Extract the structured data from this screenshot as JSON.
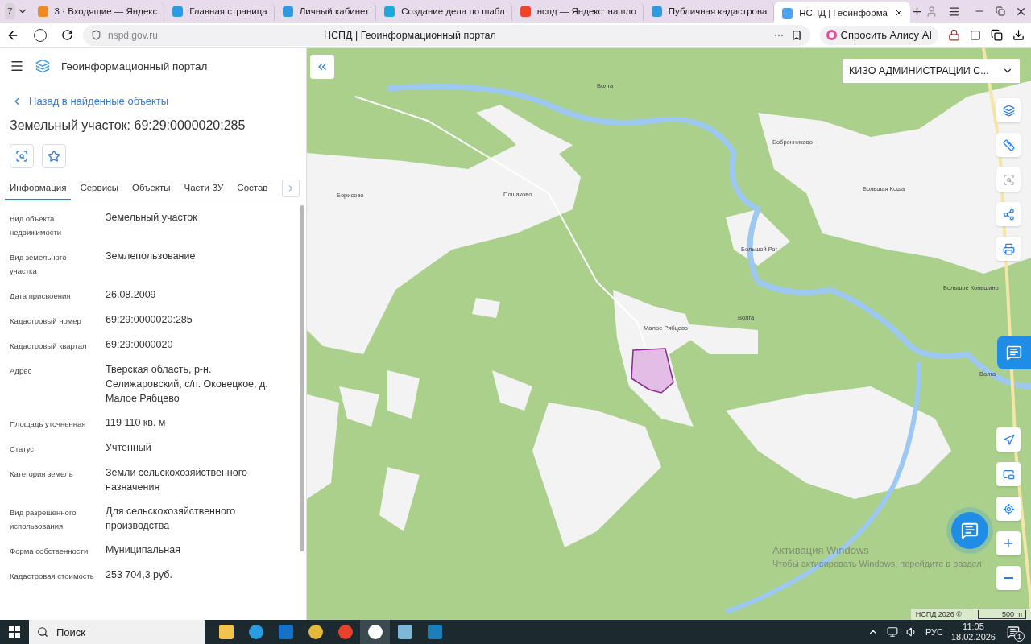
{
  "browser": {
    "tab_count": "7",
    "tabs": [
      {
        "title": "3 · Входящие — Яндекс",
        "selected": false,
        "color": "#f08a24"
      },
      {
        "title": "Главная страница",
        "selected": false,
        "color": "#2e9be0"
      },
      {
        "title": "Личный кабинет",
        "selected": false,
        "color": "#2e9be0"
      },
      {
        "title": "Создание дела по шабл",
        "selected": false,
        "color": "#1ea8e0"
      },
      {
        "title": "нспд — Яндекс: нашло",
        "selected": false,
        "color": "#f0432c"
      },
      {
        "title": "Публичная кадастрова",
        "selected": false,
        "color": "#2e9be0"
      },
      {
        "title": "НСПД | Геоинформа",
        "selected": true,
        "color": "#4aa3f0"
      }
    ],
    "url": "nspd.gov.ru",
    "page_title": "НСПД | Геоинформационный портал",
    "alice_button": "Спросить Алису AI"
  },
  "panel": {
    "portal_title": "Геоинформационный портал",
    "back_link": "Назад в найденные объекты",
    "heading": "Земельный участок: 69:29:0000020:285",
    "tabs": [
      {
        "label": "Информация",
        "selected": true
      },
      {
        "label": "Сервисы",
        "selected": false
      },
      {
        "label": "Объекты",
        "selected": false
      },
      {
        "label": "Части ЗУ",
        "selected": false
      },
      {
        "label": "Состав",
        "selected": false
      }
    ],
    "fields": [
      {
        "label": "Вид объекта недвижимости",
        "value": "Земельный участок"
      },
      {
        "label": "Вид земельного участка",
        "value": "Землепользование"
      },
      {
        "label": "Дата присвоения",
        "value": "26.08.2009"
      },
      {
        "label": "Кадастровый номер",
        "value": "69:29:0000020:285"
      },
      {
        "label": "Кадастровый квартал",
        "value": "69:29:0000020"
      },
      {
        "label": "Адрес",
        "value": "Тверская область, р-н. Селижаровский, с/п. Оковецкое, д. Малое Рябцево"
      },
      {
        "label": "Площадь уточненная",
        "value": "119 110 кв. м"
      },
      {
        "label": "Статус",
        "value": "Учтенный"
      },
      {
        "label": "Категория земель",
        "value": "Земли сельскохозяйственного назначения"
      },
      {
        "label": "Вид разрешенного использования",
        "value": "Для сельскохозяйственного производства"
      },
      {
        "label": "Форма собственности",
        "value": "Муниципальная"
      },
      {
        "label": "Кадастровая стоимость",
        "value": "253 704,3 руб."
      }
    ]
  },
  "map": {
    "layer_select": "КИЗО АДМИНИСТРАЦИИ С...",
    "labels": [
      {
        "text": "Волга"
      },
      {
        "text": "Бобронниково"
      },
      {
        "text": "Большая Коша"
      },
      {
        "text": "Борисово"
      },
      {
        "text": "Пошаково"
      },
      {
        "text": "Большой Рог"
      },
      {
        "text": "Большое Коньшино"
      },
      {
        "text": "Малое Рябцево"
      },
      {
        "text": "Волга"
      },
      {
        "text": "Волга"
      }
    ],
    "activation": [
      "Активация Windows",
      "Чтобы активировать Windows, перейдите в раздел"
    ],
    "attribution": "НСПД 2026 ©",
    "scale": "500 m"
  },
  "taskbar": {
    "search_placeholder": "Поиск",
    "language": "РУС",
    "time": "11:05",
    "date": "18.02.2026",
    "notifications": "1"
  }
}
